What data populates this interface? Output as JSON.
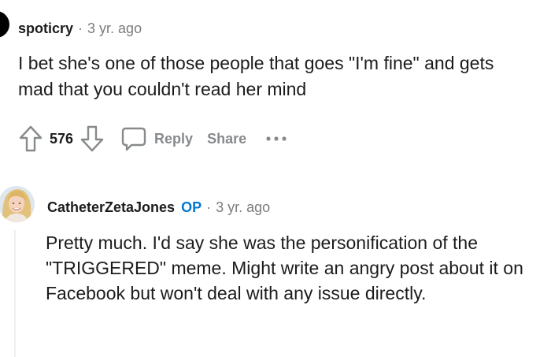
{
  "comments": [
    {
      "author": "spoticry",
      "separator": "·",
      "time": "3 yr. ago",
      "text": "I bet she's one of those people that goes \"I'm fine\" and gets mad that you couldn't read her mind",
      "score": "576",
      "actions": {
        "reply_label": "Reply",
        "share_label": "Share",
        "more_label": "•••"
      }
    },
    {
      "author": "CatheterZetaJones",
      "op_badge": "OP",
      "separator": "·",
      "time": "3 yr. ago",
      "text": "Pretty much. I'd say she was the personification of the \"TRIGGERED\" meme. Might write an angry post about it on Facebook but won't deal with any issue directly."
    }
  ],
  "icons": {
    "upvote": "arrow-up-outline-icon",
    "downvote": "arrow-down-outline-icon",
    "reply": "speech-bubble-icon",
    "more": "horizontal-dots-icon"
  },
  "colors": {
    "text": "#1c1c1c",
    "meta": "#7c7c7c",
    "action": "#878a8c",
    "op": "#0079d3",
    "thread_line": "#edeff1"
  }
}
